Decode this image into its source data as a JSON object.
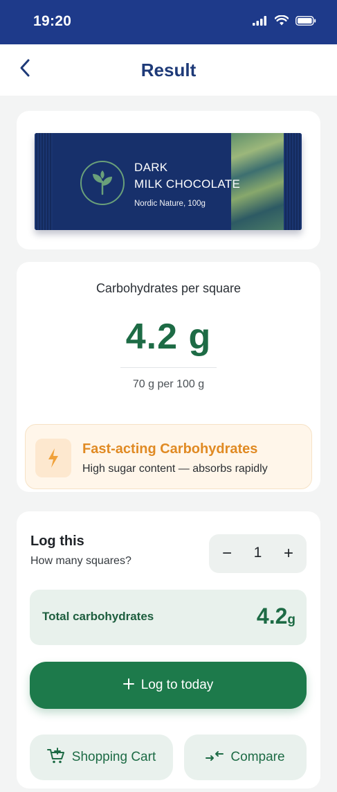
{
  "status_bar": {
    "time": "19:20",
    "icons": [
      "signal-icon",
      "wifi-icon",
      "battery-icon"
    ]
  },
  "header": {
    "back_icon": "chevron-left-icon",
    "title": "Result"
  },
  "product": {
    "line1": "DARK",
    "line2": "MILK CHOCOLATE",
    "subtitle": "Nordic Nature, 100g",
    "logo_icon": "leaf-icon"
  },
  "nutrition": {
    "label": "Carbohydrates per square",
    "value": "4.2 g",
    "per_100": "70 g per 100 g"
  },
  "alert": {
    "icon": "lightning-icon",
    "title": "Fast-acting Carbohydrates",
    "description": "High sugar content — absorbs rapidly"
  },
  "log": {
    "title": "Log this",
    "subtitle": "How many squares?",
    "stepper": {
      "minus": "−",
      "value": "1",
      "plus": "+"
    },
    "total_label": "Total carbohydrates",
    "total_value": "4.2",
    "total_unit": "g",
    "log_button": {
      "icon": "plus-icon",
      "label": "Log to today"
    },
    "cart_button": {
      "icon": "cart-plus-icon",
      "label": "Shopping Cart"
    },
    "compare_button": {
      "icon": "compare-arrows-icon",
      "label": "Compare"
    }
  },
  "colors": {
    "status_bar": "#1e3a8a",
    "title": "#1e3a78",
    "accent_green": "#1d7a4b",
    "warning_orange": "#e08a23",
    "wrapper_navy": "#17306b"
  }
}
